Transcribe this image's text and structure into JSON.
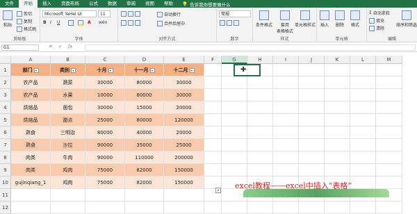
{
  "tabs": [
    "文件",
    "开始",
    "插入",
    "页面布局",
    "公式",
    "数据",
    "审阅",
    "视图",
    "帮助"
  ],
  "tell_me": "告诉我你想要做什么",
  "ribbon": {
    "clipboard": {
      "paste": "粘贴",
      "cut": "剪切",
      "copy": "复制",
      "painter": "格式刷",
      "label": "剪贴板"
    },
    "font": {
      "name": "Microsoft YaHei UI",
      "size": "11",
      "bold": "B",
      "italic": "I",
      "underline": "U",
      "wen": "wén",
      "label": "字体"
    },
    "align": {
      "wrap": "自动换行",
      "merge": "合并后居中",
      "label": "对齐方式"
    },
    "number": {
      "format": "常规",
      "label": "数字"
    },
    "styles": {
      "cond": "条件格式",
      "table": "套用\n表格格式",
      "cell": "单元格样式",
      "label": "样式"
    },
    "cells": {
      "insert": "插入",
      "delete": "删除",
      "format": "格式",
      "label": "单元格"
    },
    "edit": {
      "autosum": "自动求和",
      "fill": "填充",
      "clear": "清除",
      "sort": "排序和筛选",
      "label": "编辑"
    }
  },
  "namebox": "G1",
  "columns": [
    "A",
    "B",
    "C",
    "D",
    "E",
    "F",
    "G",
    "H",
    "I",
    "J",
    "K",
    "L",
    "M"
  ],
  "rows": [
    "1",
    "2",
    "3",
    "4",
    "5",
    "6",
    "7",
    "8",
    "9",
    "10",
    "11",
    "12"
  ],
  "table": {
    "headers": [
      "部门",
      "类别",
      "十月",
      "十一月",
      "十二月"
    ],
    "rows": [
      [
        "农产品",
        "蔬菜",
        "30000",
        "80000",
        "30000"
      ],
      [
        "农产品",
        "水果",
        "10000",
        "80000",
        "30000"
      ],
      [
        "烘焙品",
        "面包",
        "30000",
        "15000",
        "20000"
      ],
      [
        "烘焙品",
        "甜点",
        "25000",
        "80000",
        "120000"
      ],
      [
        "熟食",
        "三明治",
        "80000",
        "40000",
        "20000"
      ],
      [
        "熟食",
        "沙拉",
        "90000",
        "35000",
        "25000"
      ],
      [
        "肉类",
        "牛肉",
        "90000",
        "110000",
        "200000"
      ],
      [
        "肉类",
        "鸡肉",
        "75000",
        "82000",
        "150000"
      ],
      [
        "gujinqiang_1",
        "鸡肉",
        "75000",
        "82000",
        "150000"
      ]
    ]
  },
  "caption": "excel教程——excel中插入“表格”"
}
